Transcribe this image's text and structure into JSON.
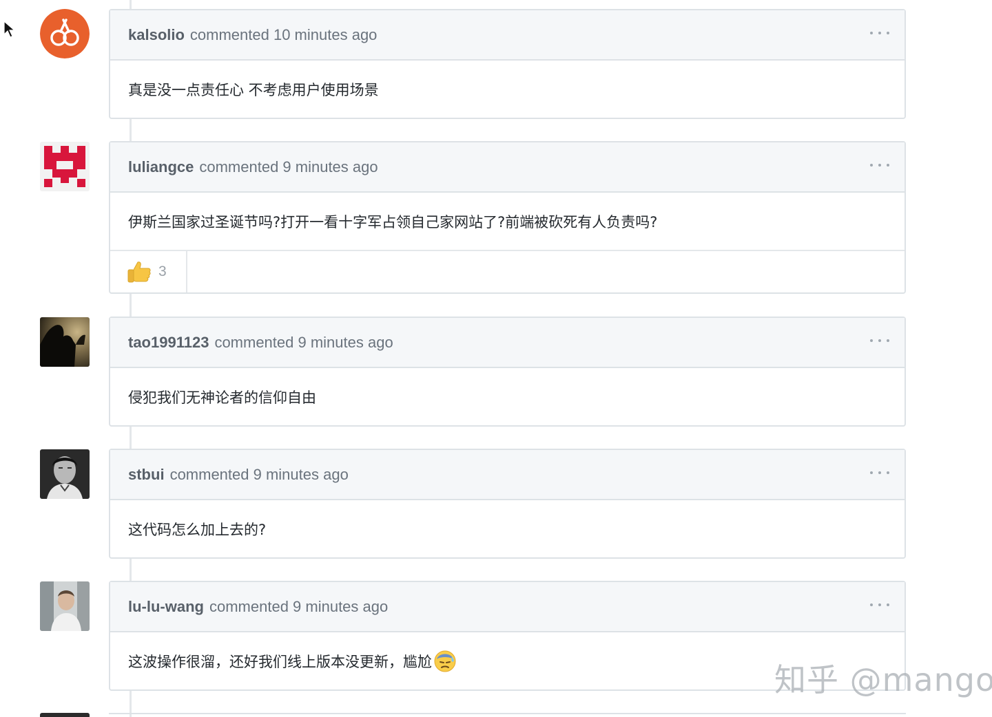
{
  "comments": [
    {
      "author": "kalsolio",
      "meta": "commented 10 minutes ago",
      "body": "真是没一点责任心 不考虑用户使用场景",
      "avatar": "orange-circle-logo-avatar"
    },
    {
      "author": "luliangce",
      "meta": "commented 9 minutes ago",
      "body": "伊斯兰国家过圣诞节吗?打开一看十字军占领自己家网站了?前端被砍死有人负责吗?",
      "avatar": "red-pixel-identicon-avatar",
      "reactions": [
        {
          "icon": "thumbs-up-icon",
          "count": "3"
        }
      ]
    },
    {
      "author": "tao1991123",
      "meta": "commented 9 minutes ago",
      "body": "侵犯我们无神论者的信仰自由",
      "avatar": "dark-silhouette-photo-avatar"
    },
    {
      "author": "stbui",
      "meta": "commented 9 minutes ago",
      "body": "这代码怎么加上去的?",
      "avatar": "black-white-portrait-avatar"
    },
    {
      "author": "lu-lu-wang",
      "meta": "commented 9 minutes ago",
      "body": "这波操作很溜，还好我们线上版本没更新，尴尬",
      "avatar": "light-photo-avatar",
      "emoji": "sweat-face-emoji"
    }
  ],
  "watermark": "知乎 @mango",
  "colors": {
    "header_bg": "#f5f7f9",
    "border": "#dde2e6",
    "avatar_orange": "#e8602c",
    "identicon_red": "#d8163c"
  }
}
